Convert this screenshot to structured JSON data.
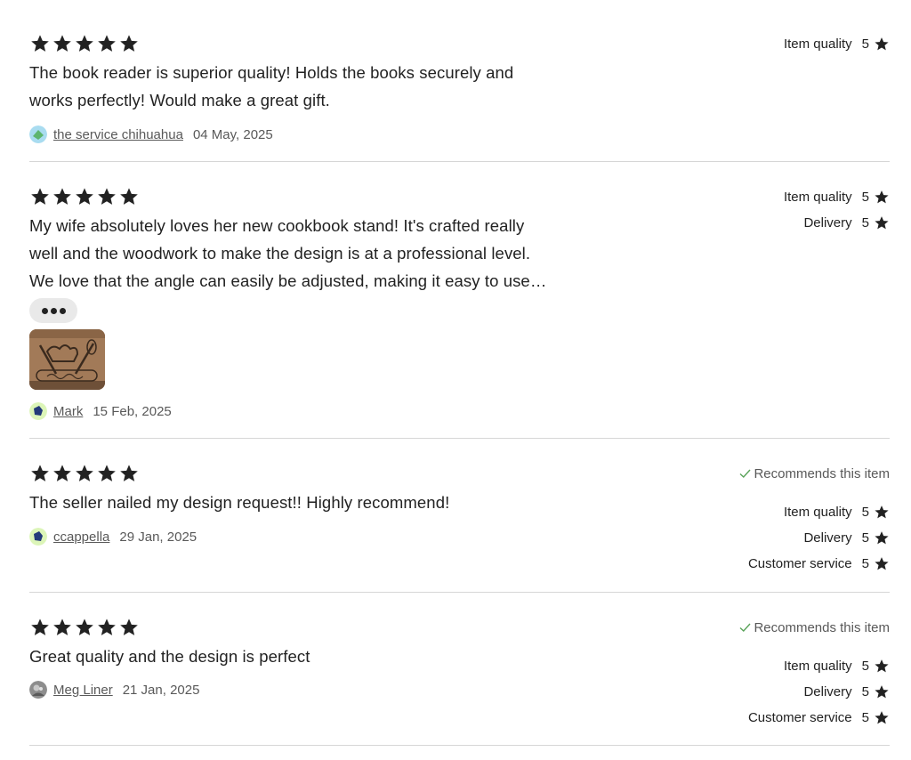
{
  "colors": {
    "text": "#222222",
    "muted": "#595959",
    "divider": "#d6d6d6",
    "check": "#5aa35a",
    "star": "#222222"
  },
  "icons": {
    "star": "star-icon",
    "more": "ellipsis-icon",
    "check": "checkmark-icon"
  },
  "reviews": [
    {
      "stars": 5,
      "text": "The book reader is superior quality! Holds the books securely and works perfectly! Would make a great gift.",
      "reviewer": "the service chihuahua",
      "date": "04 May, 2025",
      "ratings": [
        {
          "label": "Item quality",
          "value": "5"
        }
      ]
    },
    {
      "stars": 5,
      "text": "My wife absolutely loves her new cookbook stand! It's crafted really well and the woodwork to make the design is at a professional level. We love that the angle can easily be adjusted, making it easy to use while cooking.",
      "has_more": true,
      "photo": "engraved-cutting-board-photo",
      "reviewer": "Mark",
      "date": "15 Feb, 2025",
      "ratings": [
        {
          "label": "Item quality",
          "value": "5"
        },
        {
          "label": "Delivery",
          "value": "5"
        }
      ]
    },
    {
      "stars": 5,
      "text": "The seller nailed my design request!! Highly recommend!",
      "reviewer": "ccappella",
      "date": "29 Jan, 2025",
      "recommends": "Recommends this item",
      "ratings": [
        {
          "label": "Item quality",
          "value": "5"
        },
        {
          "label": "Delivery",
          "value": "5"
        },
        {
          "label": "Customer service",
          "value": "5"
        }
      ]
    },
    {
      "stars": 5,
      "text": "Great quality and the design is perfect",
      "reviewer": "Meg Liner",
      "date": "21 Jan, 2025",
      "recommends": "Recommends this item",
      "ratings": [
        {
          "label": "Item quality",
          "value": "5"
        },
        {
          "label": "Delivery",
          "value": "5"
        },
        {
          "label": "Customer service",
          "value": "5"
        }
      ]
    }
  ]
}
